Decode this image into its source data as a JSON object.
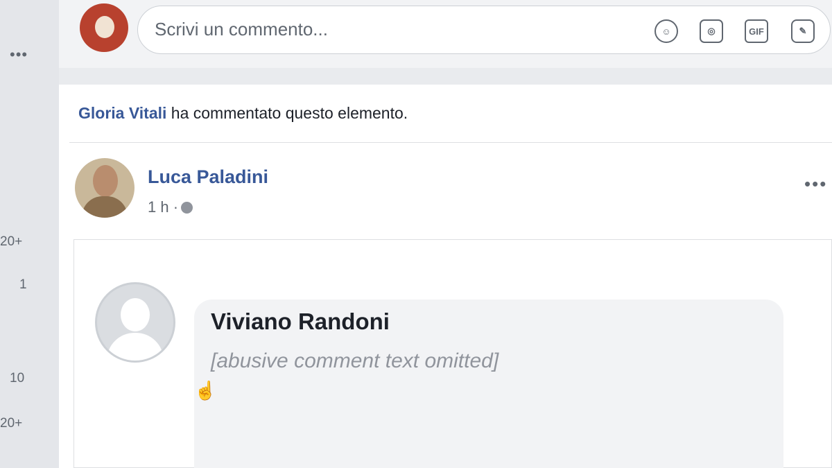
{
  "left_gutter": {
    "numbers": [
      "20+",
      "1",
      "10",
      "20+"
    ]
  },
  "comment_bar": {
    "placeholder": "Scrivi un commento...",
    "icons": [
      "emoji-icon",
      "camera-icon",
      "gif-icon",
      "sticker-icon"
    ],
    "gif_label": "GIF"
  },
  "activity": {
    "actor": "Gloria Vitali",
    "text": " ha commentato questo elemento."
  },
  "post": {
    "author": "Luca Paladini",
    "time": "1 h ·"
  },
  "shared_comment": {
    "author": "Viviano Randoni",
    "text": "[abusive comment text omitted]"
  },
  "colors": {
    "link": "#385898",
    "background": "#e9ebee",
    "bubble": "#f2f3f5"
  }
}
